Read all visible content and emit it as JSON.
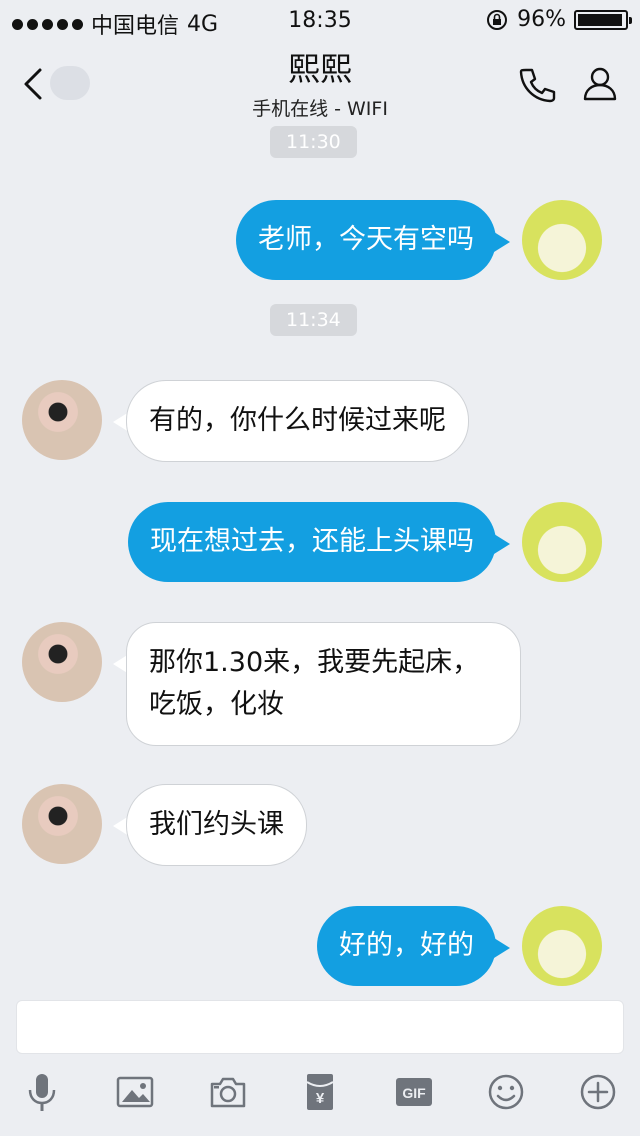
{
  "status": {
    "carrier": "中国电信",
    "network": "4G",
    "time": "18:35",
    "battery": "96%",
    "battery_level": 0.96
  },
  "nav": {
    "title": "熙熙",
    "subtitle": "手机在线 - WIFI",
    "back_icon": "chevron-left-icon",
    "call_icon": "phone-icon",
    "profile_icon": "person-icon"
  },
  "messages": [
    {
      "type": "time",
      "text": "11:30"
    },
    {
      "type": "out",
      "text": "老师，今天有空吗"
    },
    {
      "type": "time",
      "text": "11:34"
    },
    {
      "type": "in",
      "text": "有的，你什么时候过来呢"
    },
    {
      "type": "out",
      "text": "现在想过去，还能上头课吗"
    },
    {
      "type": "in",
      "text": "那你1.30来，我要先起床，吃饭，化妆"
    },
    {
      "type": "in",
      "text": "我们约头课"
    },
    {
      "type": "out",
      "text": "好的，好的"
    }
  ],
  "input": {
    "value": ""
  },
  "toolbar": {
    "items": [
      "microphone-icon",
      "image-icon",
      "camera-icon",
      "red-packet-icon",
      "gif-icon",
      "emoji-icon",
      "plus-icon"
    ],
    "gif_label": "GIF",
    "redpacket_label": "¥"
  },
  "colors": {
    "outgoing_bubble": "#139fe1",
    "incoming_bubble": "#ffffff",
    "background": "#eceef2",
    "time_chip": "#d6d8dc"
  }
}
